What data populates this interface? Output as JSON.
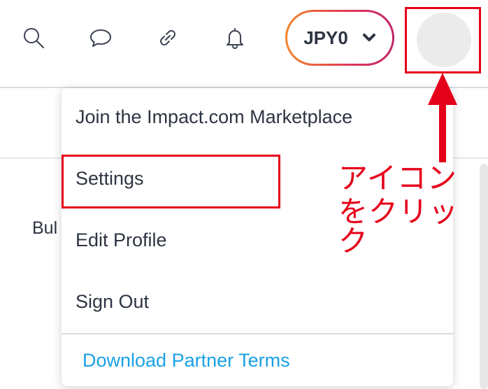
{
  "topbar": {
    "icons": [
      "search-icon",
      "chat-icon",
      "link-icon",
      "bell-icon"
    ],
    "currency_label": "JPY0"
  },
  "background": {
    "partial_text": "Bul"
  },
  "menu": {
    "items": [
      {
        "label": "Join the Impact.com Marketplace"
      },
      {
        "label": "Settings"
      },
      {
        "label": "Edit Profile"
      },
      {
        "label": "Sign Out"
      }
    ],
    "footer_link": "Download Partner Terms"
  },
  "annotation": {
    "line1": "アイコン",
    "line2": "をクリック"
  },
  "colors": {
    "annotation_red": "#e5001a",
    "link_blue": "#1aa1e3",
    "text_dark": "#2d3442"
  }
}
